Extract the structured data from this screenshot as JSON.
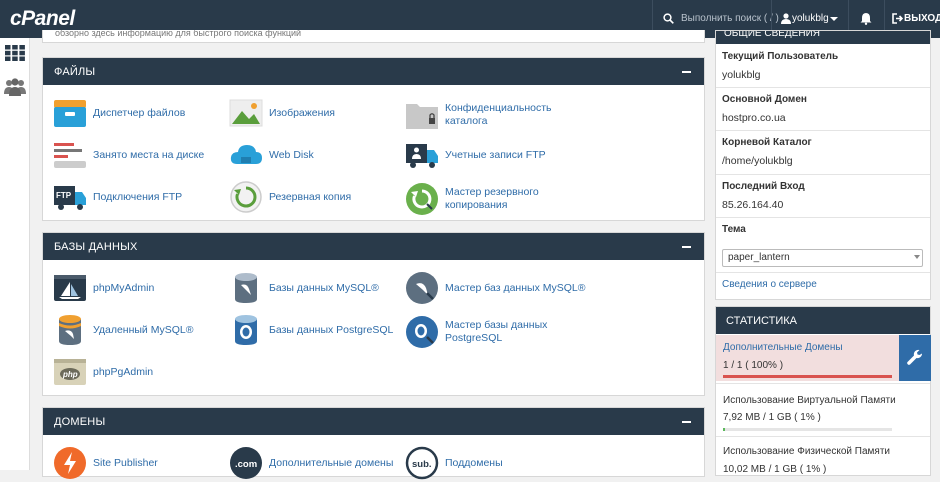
{
  "topbar": {
    "logo": "cPanel",
    "search_placeholder": "Выполнить поиск ( / )",
    "user": "yolukblg",
    "logout": "ВЫХОД"
  },
  "top_strip_text": "обзорно здесь информацию для быстрого поиска функций",
  "panels": {
    "files": {
      "title": "ФАЙЛЫ",
      "items": [
        {
          "label": "Диспетчер файлов",
          "icon": "file-manager-icon"
        },
        {
          "label": "Изображения",
          "icon": "images-icon"
        },
        {
          "label": "Конфиденциальность каталога",
          "icon": "directory-privacy-icon"
        },
        {
          "label": "Занято места на диске",
          "icon": "disk-usage-icon"
        },
        {
          "label": "Web Disk",
          "icon": "web-disk-icon"
        },
        {
          "label": "Учетные записи FTP",
          "icon": "ftp-accounts-icon"
        },
        {
          "label": "Подключения FTP",
          "icon": "ftp-connections-icon"
        },
        {
          "label": "Резервная копия",
          "icon": "backup-icon"
        },
        {
          "label": "Мастер резервного копирования",
          "icon": "backup-wizard-icon"
        }
      ]
    },
    "databases": {
      "title": "БАЗЫ ДАННЫХ",
      "items": [
        {
          "label": "phpMyAdmin",
          "icon": "phpmyadmin-icon"
        },
        {
          "label": "Базы данных MySQL®",
          "icon": "mysql-databases-icon"
        },
        {
          "label": "Мастер баз данных MySQL®",
          "icon": "mysql-wizard-icon"
        },
        {
          "label": "Удаленный MySQL®",
          "icon": "remote-mysql-icon"
        },
        {
          "label": "Базы данных PostgreSQL",
          "icon": "postgresql-databases-icon"
        },
        {
          "label": "Мастер базы данных PostgreSQL",
          "icon": "postgresql-wizard-icon"
        },
        {
          "label": "phpPgAdmin",
          "icon": "phppgadmin-icon"
        }
      ]
    },
    "domains": {
      "title": "ДОМЕНЫ",
      "items": [
        {
          "label": "Site Publisher",
          "icon": "site-publisher-icon"
        },
        {
          "label": "Дополнительные домены",
          "icon": "addon-domains-icon"
        },
        {
          "label": "Поддомены",
          "icon": "subdomains-icon"
        }
      ]
    }
  },
  "general_info": {
    "title": "ОБЩИЕ СВЕДЕНИЯ",
    "current_user_label": "Текущий Пользователь",
    "current_user": "yolukblg",
    "main_domain_label": "Основной Домен",
    "main_domain": "hostpro.co.ua",
    "root_dir_label": "Корневой Каталог",
    "root_dir": "/home/yolukblg",
    "last_login_label": "Последний Вход",
    "last_login": "85.26.164.40",
    "theme_label": "Тема",
    "theme_value": "paper_lantern",
    "server_info_link": "Сведения о сервере"
  },
  "stats": {
    "title": "СТАТИСТИКА",
    "addon_domains_label": "Дополнительные Домены",
    "addon_domains_value": "1 / 1 ( 100% )",
    "addon_domains_pct": 100,
    "vmem_label": "Использование Виртуальной Памяти",
    "vmem_value": "7,92 MB / 1 GB ( 1% )",
    "vmem_pct": 1,
    "pmem_label": "Использование Физической Памяти",
    "pmem_value": "10,02 MB / 1 GB ( 1% )"
  },
  "colors": {
    "header": "#293a4a",
    "link": "#2f6ca8",
    "danger": "#d9534f",
    "success": "#5cb85c"
  }
}
